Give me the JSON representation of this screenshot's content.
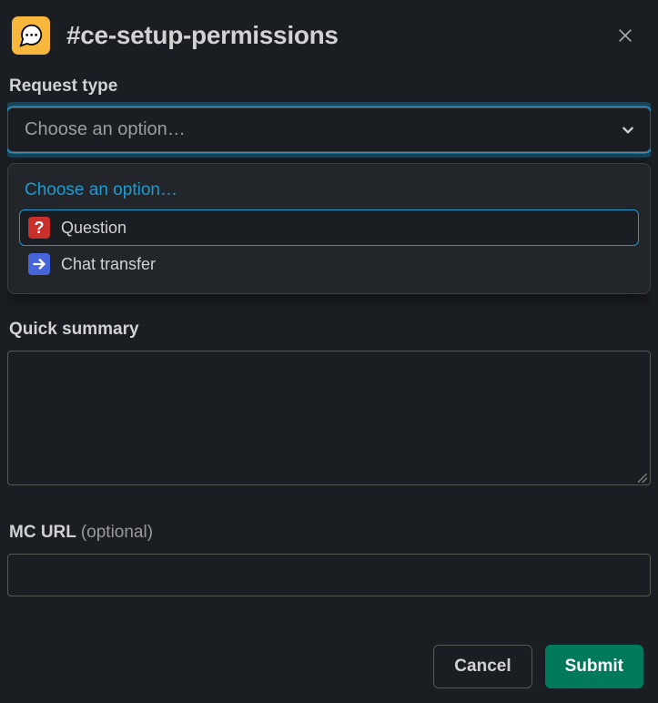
{
  "header": {
    "title": "#ce-setup-permissions"
  },
  "request_type": {
    "label": "Request type",
    "placeholder": "Choose an option…",
    "dropdown": {
      "header": "Choose an option…",
      "options": [
        {
          "icon": "question-icon",
          "label": "Question"
        },
        {
          "icon": "arrow-right-icon",
          "label": "Chat transfer"
        }
      ]
    }
  },
  "quick_summary": {
    "label": "Quick summary",
    "value": ""
  },
  "mc_url": {
    "label": "MC URL",
    "optional_text": "(optional)",
    "value": ""
  },
  "footer": {
    "cancel": "Cancel",
    "submit": "Submit"
  }
}
